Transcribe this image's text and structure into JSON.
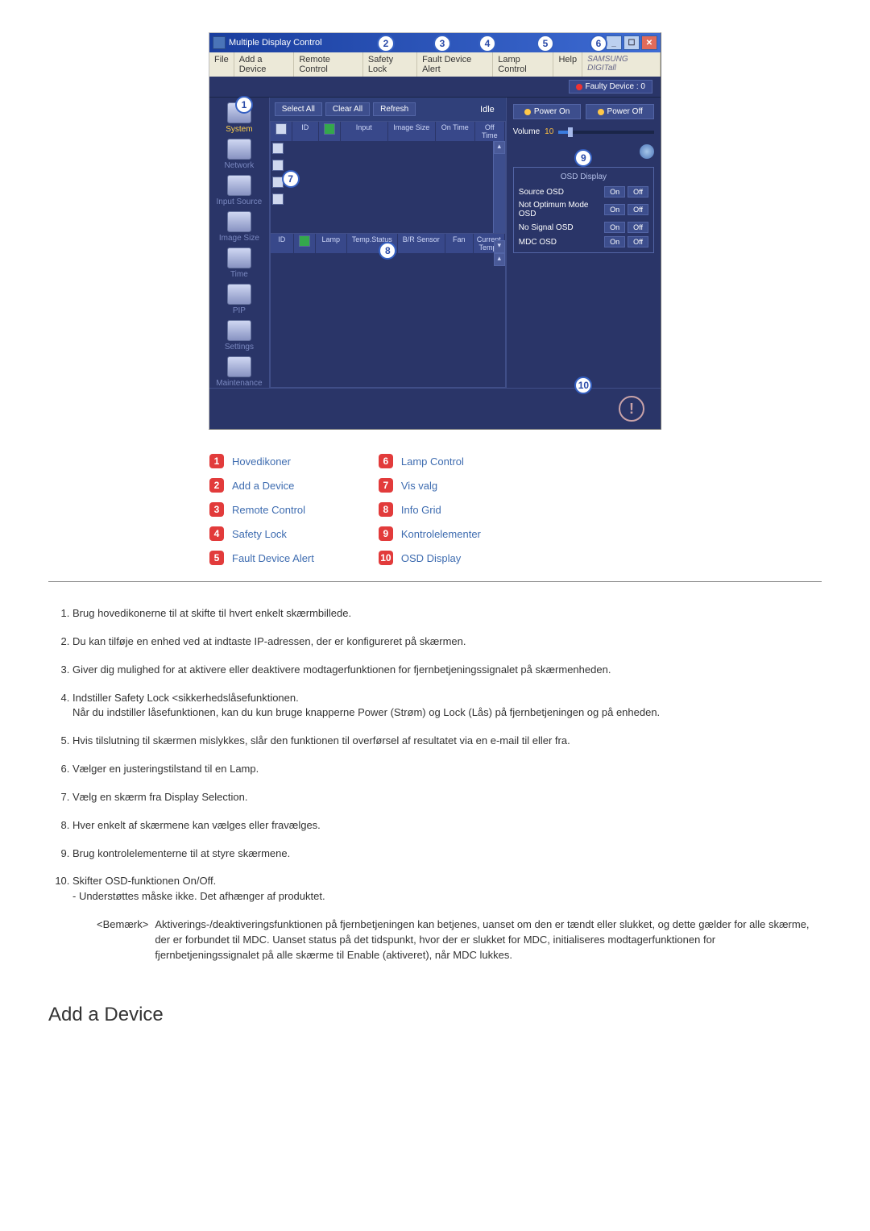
{
  "app": {
    "title": "Multiple Display Control",
    "brand": "SAMSUNG DIGITall",
    "menu": {
      "file": "File",
      "add": "Add a Device",
      "remote": "Remote Control",
      "safety": "Safety Lock",
      "fault": "Fault Device Alert",
      "lamp": "Lamp Control",
      "help": "Help"
    },
    "faulty": "Faulty Device : 0",
    "toolbar": {
      "select_all": "Select All",
      "clear_all": "Clear All",
      "refresh": "Refresh",
      "idle": "Idle"
    },
    "sidebar": {
      "system": "System",
      "network": "Network",
      "input_source": "Input Source",
      "image_size": "Image Size",
      "time": "Time",
      "pip": "PIP",
      "settings": "Settings",
      "maintenance": "Maintenance"
    },
    "grid_upper_headers": {
      "chk": "",
      "id": "ID",
      "pwr": "",
      "input": "Input",
      "image_size": "Image Size",
      "on_time": "On Time",
      "off_time": "Off Time"
    },
    "grid_lower_headers": {
      "id": "ID",
      "pwr": "",
      "lamp": "Lamp",
      "temp_status": "Temp.Status",
      "br_sensor": "B/R Sensor",
      "fan": "Fan",
      "current_temp": "Current Temp."
    },
    "power": {
      "on": "Power On",
      "off": "Power Off",
      "volume_label": "Volume",
      "volume_value": "10"
    },
    "osd": {
      "title": "OSD Display",
      "source": "Source OSD",
      "not_optimum": "Not Optimum Mode OSD",
      "no_signal": "No Signal OSD",
      "mdc": "MDC OSD",
      "on": "On",
      "off": "Off"
    }
  },
  "legend": {
    "l1": "Hovedikoner",
    "l2": "Add a Device",
    "l3": "Remote Control",
    "l4": "Safety Lock",
    "l5": "Fault Device Alert",
    "l6": "Lamp Control",
    "l7": "Vis valg",
    "l8": "Info Grid",
    "l9": "Kontrolelementer",
    "l10": "OSD Display"
  },
  "descriptions": {
    "d1": "Brug hovedikonerne til at skifte til hvert enkelt skærmbillede.",
    "d2": "Du kan tilføje en enhed ved at indtaste IP-adressen, der er konfigureret på skærmen.",
    "d3": "Giver dig mulighed for at aktivere eller deaktivere modtagerfunktionen for fjernbetjeningssignalet på skærmenheden.",
    "d4a": "Indstiller Safety Lock <sikkerhedslåsefunktionen.",
    "d4b": "Når du indstiller låsefunktionen, kan du kun bruge knapperne Power (Strøm) og Lock (Lås) på fjernbetjeningen og på enheden.",
    "d5": "Hvis tilslutning til skærmen mislykkes, slår den funktionen til overførsel af resultatet via en e-mail til eller fra.",
    "d6": "Vælger en justeringstilstand til en Lamp.",
    "d7": "Vælg en skærm fra Display Selection.",
    "d8": "Hver enkelt af skærmene kan vælges eller fravælges.",
    "d9": "Brug kontrolelementerne til at styre skærmene.",
    "d10a": "Skifter OSD-funktionen On/Off.",
    "d10b": "- Understøttes måske ikke. Det afhænger af produktet.",
    "note_label": "<Bemærk>",
    "note_text": "Aktiverings-/deaktiveringsfunktionen på fjernbetjeningen kan betjenes, uanset om den er tændt eller slukket, og dette gælder for alle skærme, der er forbundet til MDC. Uanset status på det tidspunkt, hvor der er slukket for MDC, initialiseres modtagerfunktionen for fjernbetjeningssignalet på alle skærme til Enable (aktiveret), når MDC lukkes."
  },
  "heading": "Add a Device"
}
